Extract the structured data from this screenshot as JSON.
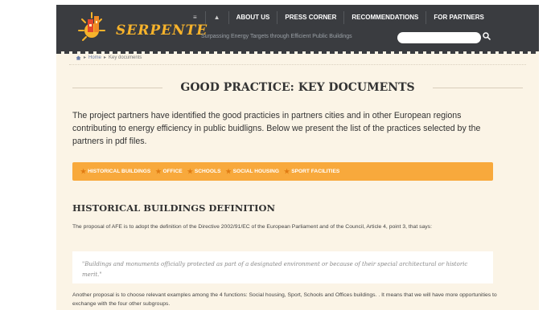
{
  "header": {
    "logo_text": "SERPENTE",
    "tagline": "Surpassing Energy Targets through Efficient Public Buildings",
    "nav": [
      {
        "icon": "home-icon",
        "label": "≡"
      },
      {
        "icon": "up-icon",
        "label": "▲"
      },
      {
        "label": "ABOUT US"
      },
      {
        "label": "PRESS CORNER"
      },
      {
        "label": "RECOMMENDATIONS"
      },
      {
        "label": "FOR PARTNERS"
      }
    ],
    "search_placeholder": ""
  },
  "breadcrumb": {
    "home": "Home",
    "current": "Key documents"
  },
  "main": {
    "title": "GOOD PRACTICE: KEY DOCUMENTS",
    "intro": "The project partners have identified the good practicies in partners cities and in other European regions contributing to energy efficiency in public buidligns. Below we present the list of the practices selected by the partners in pdf files.",
    "categories": [
      "HISTORICAL BUILDINGS",
      "OFFICE",
      "SCHOOLS",
      "SOCIAL HOUSING",
      "SPORT FACILITIES"
    ],
    "section_title": "HISTORICAL BUILDINGS DEFINITION",
    "paragraph1": "The proposal of AFE is to adopt the definition of the Directive 2002/91/EC of the European Parliament and of the Council, Article 4, point 3, that says:",
    "quote": "\"Buildings and monuments officially protected as part of a designated environment or because of their special architectural or historic merit.\"",
    "paragraph2": "Another proposal is to choose relevant examples among the 4 functions: Social housing, Sport, Schools and Offices buildings. . It means that we will have more opportunities to exchange with the four other subgroups."
  },
  "colors": {
    "header_bg": "#3a3c40",
    "page_bg": "#fbf4e6",
    "accent_orange": "#f8a93c",
    "logo_yellow": "#f7b32b"
  }
}
